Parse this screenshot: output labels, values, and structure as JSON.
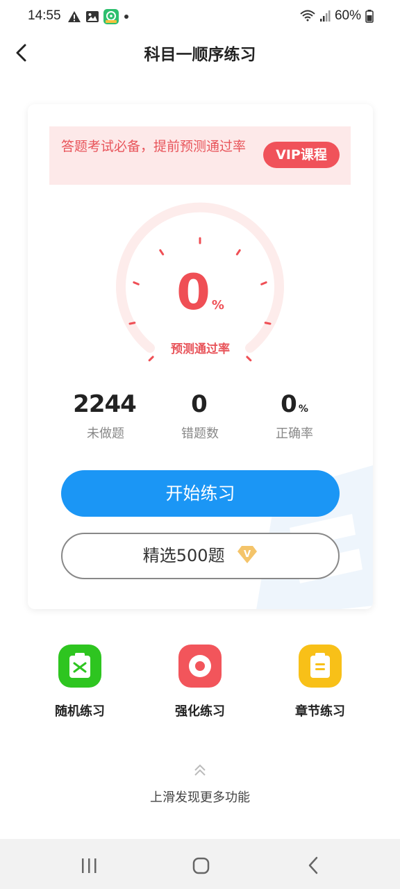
{
  "status_bar": {
    "time": "14:55",
    "battery": "60%",
    "icons": [
      "alert-icon",
      "image-icon",
      "app-icon",
      "dot-icon",
      "wifi-icon",
      "signal-icon",
      "battery-icon"
    ]
  },
  "header": {
    "title": "科目一顺序练习",
    "back_icon": "chevron-left-icon"
  },
  "vip_banner": {
    "text": "答题考试必备，提前预测通过率",
    "button_label": "VIP课程"
  },
  "gauge": {
    "value": "0",
    "unit": "%",
    "label": "预测通过率"
  },
  "stats": [
    {
      "value": "2244",
      "unit": "",
      "label": "未做题"
    },
    {
      "value": "0",
      "unit": "",
      "label": "错题数"
    },
    {
      "value": "0",
      "unit": "%",
      "label": "正确率"
    }
  ],
  "buttons": {
    "start_label": "开始练习",
    "select_label": "精选500题",
    "select_badge": "V"
  },
  "features": [
    {
      "label": "随机练习",
      "icon": "shuffle-icon",
      "color": "#2ec520"
    },
    {
      "label": "强化练习",
      "icon": "target-icon",
      "color": "#f2555b"
    },
    {
      "label": "章节练习",
      "icon": "clipboard-icon",
      "color": "#f8c018"
    }
  ],
  "more": {
    "text": "上滑发现更多功能",
    "icon": "double-chevron-up-icon"
  },
  "colors": {
    "accent_blue": "#1b96f5",
    "accent_red": "#ef4f55",
    "banner_bg": "#fde9e9"
  }
}
